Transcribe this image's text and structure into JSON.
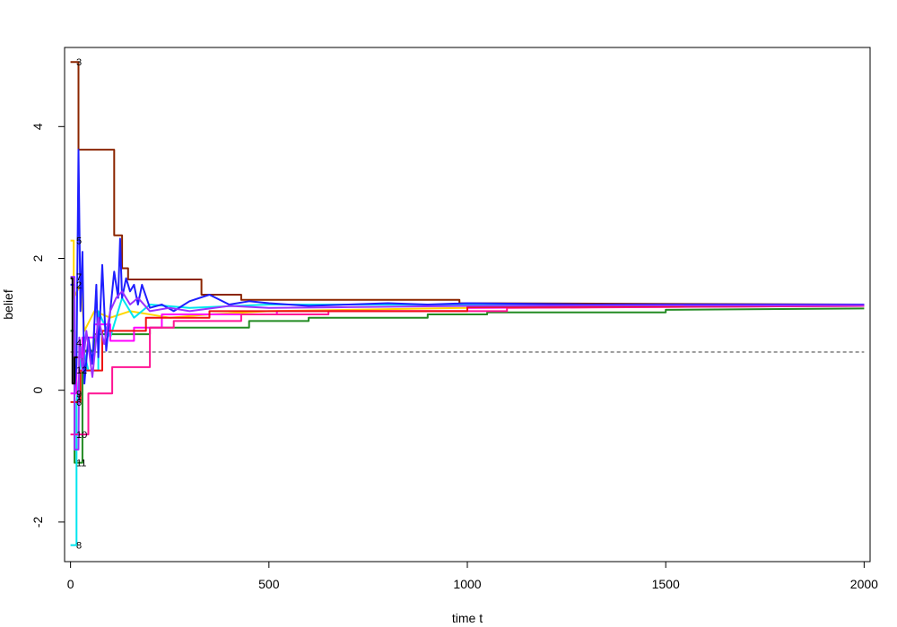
{
  "chart_data": {
    "type": "line",
    "title": "",
    "xlabel": "time t",
    "ylabel": "belief",
    "xlim": [
      -15,
      2015
    ],
    "ylim": [
      -2.6,
      5.2
    ],
    "x_ticks": [
      0,
      500,
      1000,
      1500,
      2000
    ],
    "y_ticks": [
      -2,
      0,
      2,
      4
    ],
    "x_tick_labels": [
      "0",
      "500",
      "1000",
      "1500",
      "2000"
    ],
    "y_tick_labels": [
      "-2",
      "0",
      "2",
      "4"
    ],
    "grid": false,
    "legend": "none",
    "reference_line": {
      "y": 0.58,
      "style": "dashed",
      "color": "#666666"
    },
    "agent_labels": [
      {
        "text": "3",
        "value": 4.98
      },
      {
        "text": "5",
        "value": 2.27
      },
      {
        "text": "7",
        "value": 1.72
      },
      {
        "text": "2",
        "value": 1.6
      },
      {
        "text": "4",
        "value": 0.72
      },
      {
        "text": "12",
        "value": 0.31
      },
      {
        "text": "9",
        "value": -0.05
      },
      {
        "text": "1",
        "value": -0.1
      },
      {
        "text": "6",
        "value": -0.18
      },
      {
        "text": "10",
        "value": -0.67
      },
      {
        "text": "11",
        "value": -1.1
      },
      {
        "text": "8",
        "value": -2.35
      }
    ],
    "series": [
      {
        "color": "#8B2500",
        "points": [
          [
            0,
            4.98
          ],
          [
            20,
            4.98
          ],
          [
            20,
            3.65
          ],
          [
            110,
            3.65
          ],
          [
            110,
            2.35
          ],
          [
            130,
            2.35
          ],
          [
            130,
            1.85
          ],
          [
            145,
            1.85
          ],
          [
            145,
            1.68
          ],
          [
            330,
            1.68
          ],
          [
            330,
            1.45
          ],
          [
            430,
            1.45
          ],
          [
            430,
            1.37
          ],
          [
            980,
            1.37
          ],
          [
            980,
            1.32
          ],
          [
            2000,
            1.3
          ]
        ]
      },
      {
        "color": "#228B22",
        "points": [
          [
            0,
            0.9
          ],
          [
            10,
            0.9
          ],
          [
            10,
            -1.1
          ],
          [
            30,
            -1.1
          ],
          [
            30,
            0.6
          ],
          [
            60,
            0.6
          ],
          [
            60,
            0.85
          ],
          [
            200,
            0.85
          ],
          [
            200,
            0.95
          ],
          [
            450,
            0.95
          ],
          [
            450,
            1.05
          ],
          [
            600,
            1.05
          ],
          [
            600,
            1.1
          ],
          [
            900,
            1.1
          ],
          [
            900,
            1.15
          ],
          [
            1050,
            1.15
          ],
          [
            1050,
            1.18
          ],
          [
            1500,
            1.18
          ],
          [
            1500,
            1.22
          ],
          [
            2000,
            1.24
          ]
        ]
      },
      {
        "color": "#FFD700",
        "points": [
          [
            0,
            2.27
          ],
          [
            8,
            2.27
          ],
          [
            8,
            1.4
          ],
          [
            25,
            1.6
          ],
          [
            35,
            0.9
          ],
          [
            60,
            1.2
          ],
          [
            100,
            1.1
          ],
          [
            150,
            1.2
          ],
          [
            250,
            1.1
          ],
          [
            350,
            1.15
          ],
          [
            500,
            1.2
          ],
          [
            700,
            1.22
          ],
          [
            1000,
            1.25
          ],
          [
            2000,
            1.28
          ]
        ]
      },
      {
        "color": "#00E5EE",
        "points": [
          [
            0,
            -2.35
          ],
          [
            15,
            -2.35
          ],
          [
            15,
            -0.2
          ],
          [
            30,
            0.7
          ],
          [
            45,
            0.3
          ],
          [
            70,
            0.3
          ],
          [
            70,
            1.2
          ],
          [
            100,
            0.8
          ],
          [
            130,
            1.4
          ],
          [
            160,
            1.1
          ],
          [
            200,
            1.3
          ],
          [
            300,
            1.25
          ],
          [
            500,
            1.3
          ],
          [
            1000,
            1.3
          ],
          [
            2000,
            1.3
          ]
        ]
      },
      {
        "color": "#FF00FF",
        "points": [
          [
            0,
            -0.05
          ],
          [
            15,
            -0.05
          ],
          [
            15,
            0.5
          ],
          [
            30,
            0.5
          ],
          [
            30,
            0.8
          ],
          [
            60,
            0.8
          ],
          [
            60,
            1.0
          ],
          [
            100,
            1.0
          ],
          [
            100,
            0.75
          ],
          [
            160,
            0.75
          ],
          [
            160,
            0.95
          ],
          [
            230,
            0.95
          ],
          [
            230,
            1.15
          ],
          [
            520,
            1.15
          ],
          [
            520,
            1.2
          ],
          [
            1000,
            1.2
          ],
          [
            1000,
            1.25
          ],
          [
            2000,
            1.28
          ]
        ]
      },
      {
        "color": "#FF1493",
        "points": [
          [
            0,
            -0.67
          ],
          [
            45,
            -0.67
          ],
          [
            45,
            -0.05
          ],
          [
            105,
            -0.05
          ],
          [
            105,
            0.35
          ],
          [
            200,
            0.35
          ],
          [
            200,
            0.95
          ],
          [
            260,
            0.95
          ],
          [
            260,
            1.05
          ],
          [
            430,
            1.05
          ],
          [
            430,
            1.15
          ],
          [
            650,
            1.15
          ],
          [
            650,
            1.2
          ],
          [
            1100,
            1.2
          ],
          [
            1100,
            1.25
          ],
          [
            2000,
            1.28
          ]
        ]
      },
      {
        "color": "#EE1111",
        "points": [
          [
            0,
            -0.18
          ],
          [
            25,
            -0.18
          ],
          [
            25,
            0.3
          ],
          [
            80,
            0.3
          ],
          [
            80,
            0.9
          ],
          [
            190,
            0.9
          ],
          [
            190,
            1.1
          ],
          [
            350,
            1.1
          ],
          [
            350,
            1.2
          ],
          [
            1000,
            1.2
          ],
          [
            1000,
            1.26
          ],
          [
            2000,
            1.29
          ]
        ]
      },
      {
        "color": "#1E1EFF",
        "points": [
          [
            0,
            1.6
          ],
          [
            10,
            1.6
          ],
          [
            10,
            0.0
          ],
          [
            15,
            0.4
          ],
          [
            20,
            3.65
          ],
          [
            25,
            1.2
          ],
          [
            30,
            2.1
          ],
          [
            35,
            0.1
          ],
          [
            45,
            0.8
          ],
          [
            55,
            0.4
          ],
          [
            65,
            1.6
          ],
          [
            70,
            0.5
          ],
          [
            80,
            1.9
          ],
          [
            90,
            0.6
          ],
          [
            100,
            1.2
          ],
          [
            110,
            1.8
          ],
          [
            120,
            1.4
          ],
          [
            125,
            2.3
          ],
          [
            130,
            1.4
          ],
          [
            140,
            1.7
          ],
          [
            150,
            1.5
          ],
          [
            160,
            1.6
          ],
          [
            170,
            1.3
          ],
          [
            180,
            1.6
          ],
          [
            200,
            1.25
          ],
          [
            230,
            1.3
          ],
          [
            260,
            1.2
          ],
          [
            300,
            1.35
          ],
          [
            350,
            1.45
          ],
          [
            400,
            1.3
          ],
          [
            450,
            1.35
          ],
          [
            500,
            1.32
          ],
          [
            600,
            1.28
          ],
          [
            700,
            1.3
          ],
          [
            800,
            1.32
          ],
          [
            900,
            1.3
          ],
          [
            1000,
            1.32
          ],
          [
            1300,
            1.3
          ],
          [
            2000,
            1.3
          ]
        ]
      },
      {
        "color": "#9B30FF",
        "points": [
          [
            0,
            1.72
          ],
          [
            10,
            1.72
          ],
          [
            10,
            -0.9
          ],
          [
            20,
            -0.9
          ],
          [
            22,
            0.8
          ],
          [
            30,
            0.3
          ],
          [
            40,
            0.9
          ],
          [
            55,
            0.2
          ],
          [
            70,
            1.1
          ],
          [
            85,
            0.7
          ],
          [
            100,
            1.2
          ],
          [
            115,
            1.4
          ],
          [
            130,
            1.5
          ],
          [
            150,
            1.3
          ],
          [
            170,
            1.4
          ],
          [
            200,
            1.2
          ],
          [
            250,
            1.25
          ],
          [
            300,
            1.2
          ],
          [
            400,
            1.28
          ],
          [
            500,
            1.25
          ],
          [
            700,
            1.26
          ],
          [
            1000,
            1.28
          ],
          [
            2000,
            1.29
          ]
        ]
      },
      {
        "color": "#000000",
        "points": [
          [
            0,
            1.7
          ],
          [
            5,
            1.7
          ],
          [
            5,
            0.1
          ],
          [
            10,
            0.1
          ],
          [
            10,
            0.5
          ],
          [
            18,
            0.5
          ]
        ]
      }
    ]
  }
}
